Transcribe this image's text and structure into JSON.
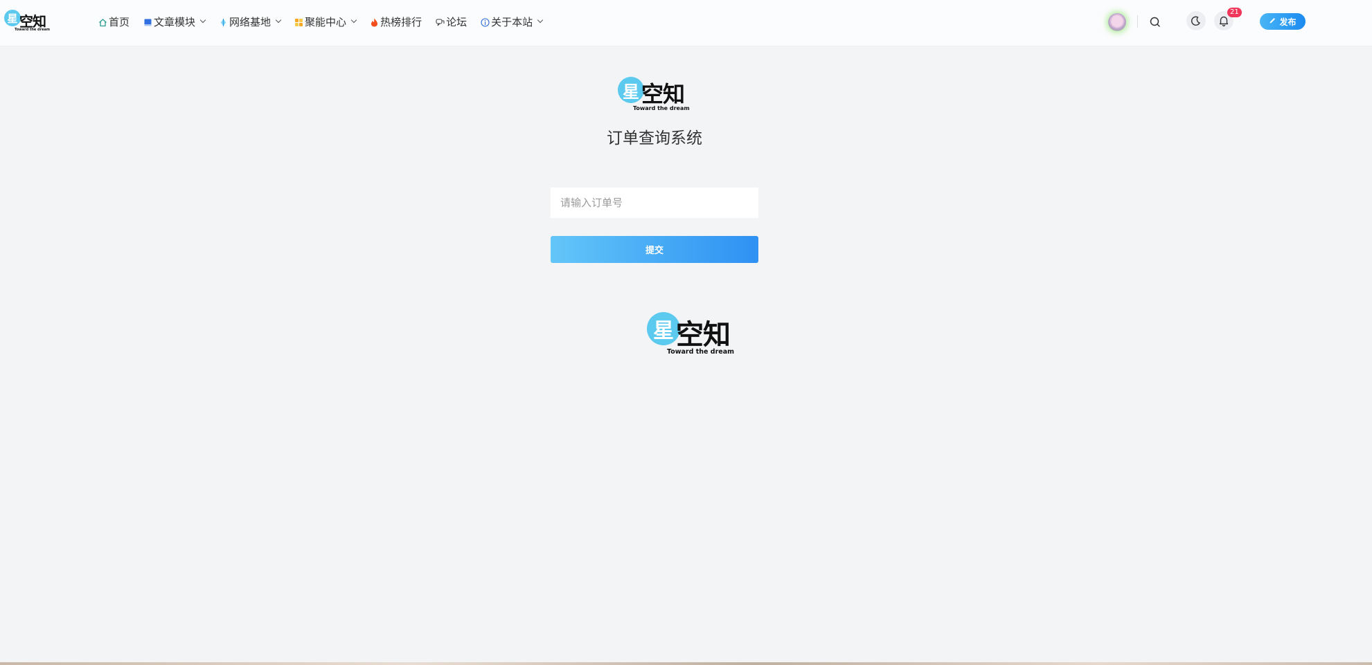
{
  "brand": {
    "logo_char": "星",
    "logo_name": "空知",
    "slogan": "Toward the dream",
    "accent": "#5cc9ee"
  },
  "nav": {
    "items": [
      {
        "label": "首页",
        "icon": "home-icon",
        "dropdown": false
      },
      {
        "label": "文章模块",
        "icon": "book-icon",
        "dropdown": true
      },
      {
        "label": "网络基地",
        "icon": "diamond-icon",
        "dropdown": true
      },
      {
        "label": "聚能中心",
        "icon": "grid-icon",
        "dropdown": true
      },
      {
        "label": "热榜排行",
        "icon": "fire-icon",
        "dropdown": false
      },
      {
        "label": "论坛",
        "icon": "chat-icon",
        "dropdown": false
      },
      {
        "label": "关于本站",
        "icon": "info-icon",
        "dropdown": true
      }
    ]
  },
  "header_right": {
    "notification_count": "21",
    "publish_label": "发布",
    "publish_color": "#1b8af0",
    "badge_color": "#f0365a"
  },
  "main": {
    "title": "订单查询系统",
    "input_placeholder": "请输入订单号",
    "input_value": "",
    "submit_label": "提交"
  }
}
